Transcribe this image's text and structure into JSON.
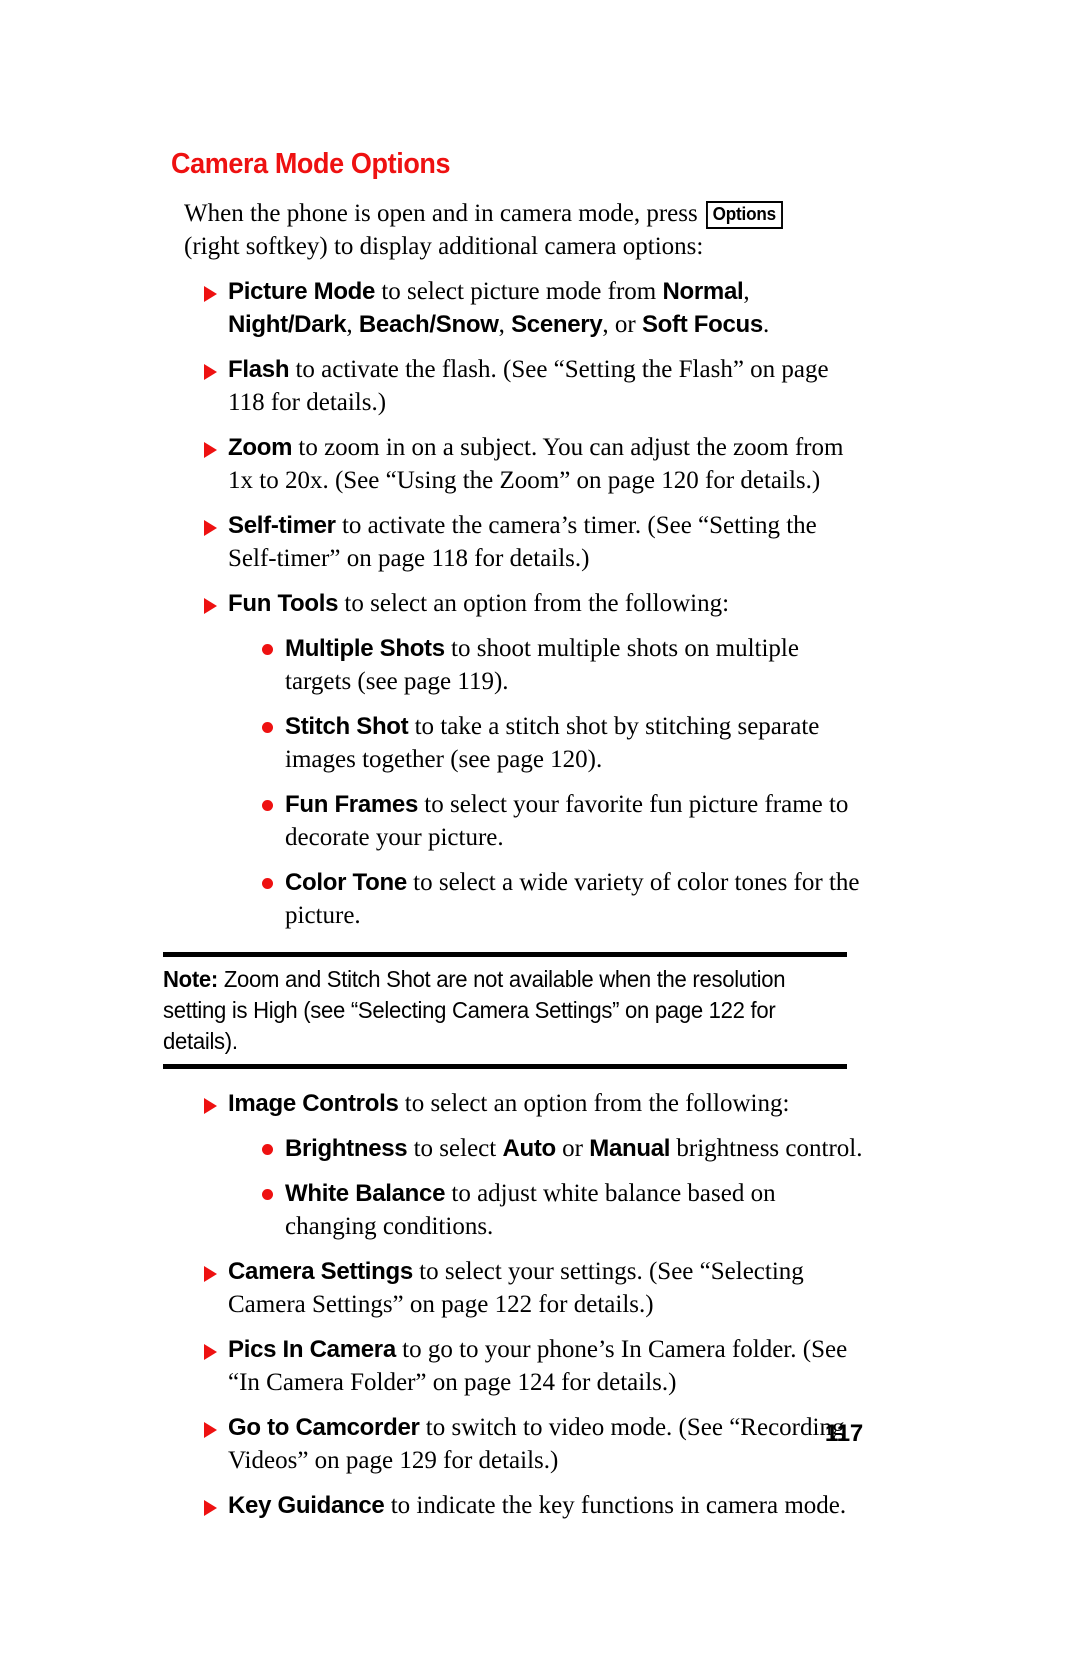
{
  "page": {
    "heading": "Camera Mode Options",
    "folio": "117"
  },
  "intro": {
    "before": "When the phone is open and in camera mode, press ",
    "softkey": "Options",
    "after": " (right softkey) to display additional camera options:"
  },
  "bullets_top": [
    {
      "term": "Picture Mode",
      "text_1": " to select picture mode from ",
      "opt_1": "Normal",
      "sep_1": ", ",
      "opt_2": "Night/Dark",
      "sep_2": ", ",
      "opt_3": "Beach/Snow",
      "sep_3": ", ",
      "opt_4": "Scenery",
      "sep_4": ", or ",
      "opt_5": "Soft Focus",
      "tail": "."
    },
    {
      "term": "Flash",
      "text": " to activate the flash. (See “Setting the Flash” on page 118 for details.)"
    },
    {
      "term": "Zoom",
      "text": " to zoom in on a subject. You can adjust the zoom from 1x to 20x. (See “Using the Zoom” on page 120 for details.)"
    },
    {
      "term": "Self-timer",
      "text": " to activate the camera’s timer. (See “Setting the Self-timer” on page 118 for details.)"
    },
    {
      "term": "Fun Tools",
      "text": " to select an option from the following:"
    }
  ],
  "fun_tools_sub": [
    {
      "term": "Multiple Shots",
      "text": " to shoot multiple shots on multiple targets (see page 119)."
    },
    {
      "term": "Stitch Shot",
      "text": " to take a stitch shot by stitching separate images together (see page 120)."
    },
    {
      "term": "Fun Frames",
      "text": " to select your favorite fun picture frame to decorate your picture."
    },
    {
      "term": "Color Tone",
      "text": " to select a wide variety of color tones for the picture."
    }
  ],
  "note": {
    "label": "Note:",
    "text": " Zoom and Stitch Shot are not available when the resolution setting is High (see “Selecting Camera Settings” on page 122 for details)."
  },
  "image_controls": {
    "term": "Image Controls",
    "text": " to select an option from the following:"
  },
  "image_controls_sub": [
    {
      "term": "Brightness",
      "text_1": " to select ",
      "opt_1": "Auto",
      "sep_1": " or ",
      "opt_2": "Manual",
      "tail": " brightness control."
    },
    {
      "term": "White Balance",
      "text": " to adjust white balance based on changing conditions."
    }
  ],
  "bullets_bottom": [
    {
      "term": "Camera Settings",
      "text": " to select your settings. (See “Selecting Camera Settings” on page 122 for details.)"
    },
    {
      "term": "Pics In Camera",
      "text": " to go to your phone’s In Camera folder. (See “In Camera Folder” on page 124 for details.)"
    },
    {
      "term": "Go to Camcorder",
      "text": " to switch to video mode. (See “Recording Videos” on page 129 for details.)"
    },
    {
      "term": "Key Guidance",
      "text": " to indicate the key functions in camera mode."
    }
  ],
  "colors": {
    "accent_red": "#ee1111",
    "text_black": "#000000",
    "background": "#ffffff"
  }
}
